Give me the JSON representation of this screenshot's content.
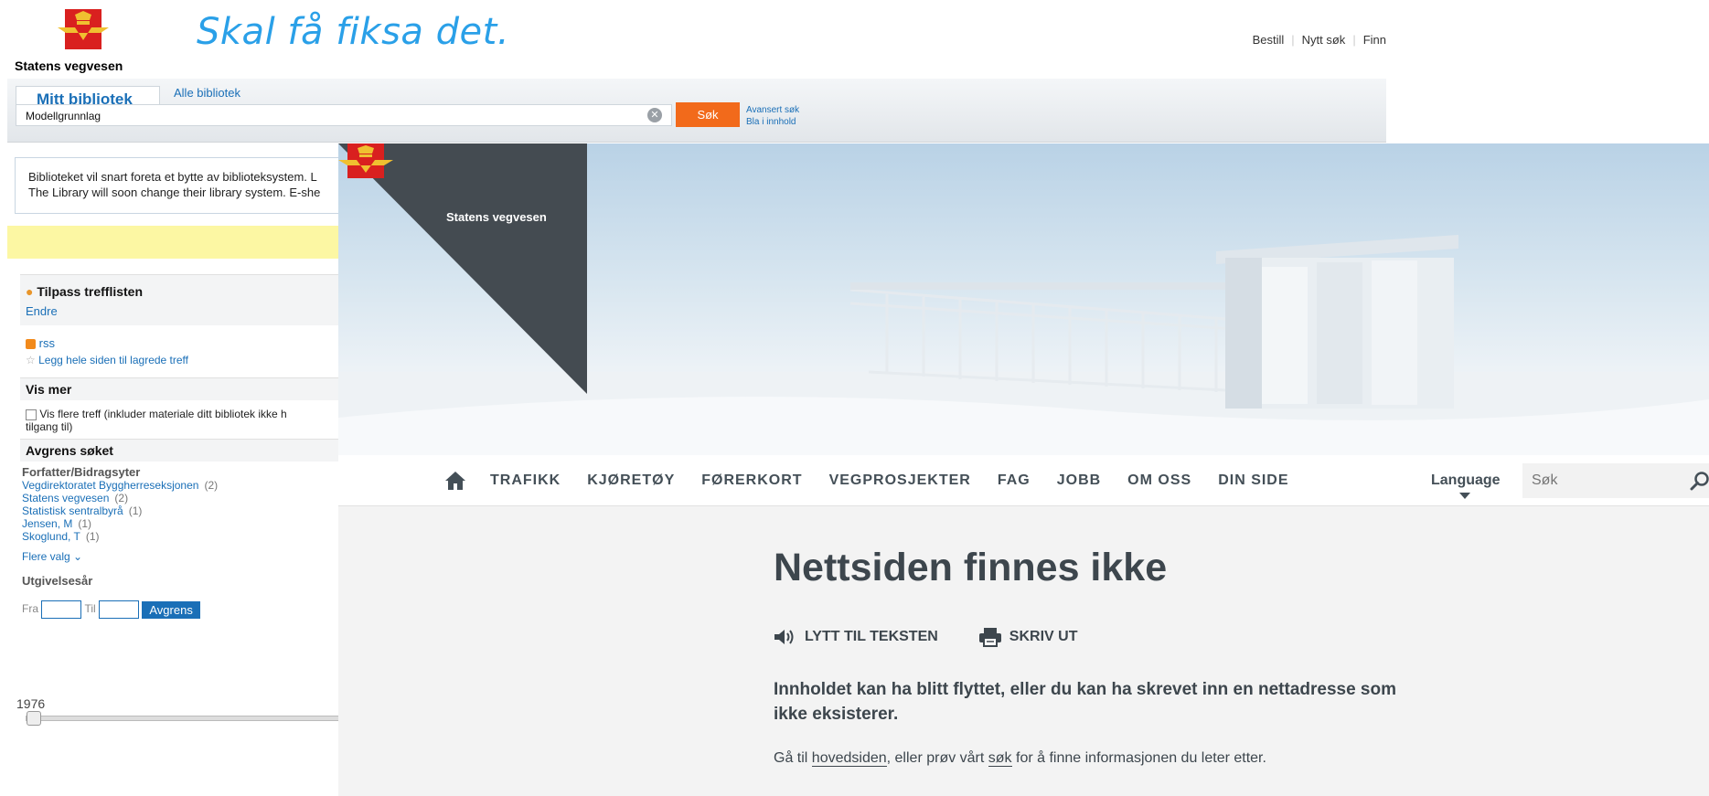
{
  "library": {
    "brand_name": "Statens vegvesen",
    "handwriting": "Skal få fiksa det.",
    "top_links": [
      "Bestill",
      "Nytt søk",
      "Finn"
    ],
    "tabs": {
      "active": "Mitt bibliotek",
      "other": "Alle bibliotek"
    },
    "search": {
      "value": "Modellgrunnlag",
      "button": "Søk"
    },
    "advanced": {
      "advanced_search": "Avansert søk",
      "browse": "Bla i innhold"
    },
    "notice": {
      "line1": "Biblioteket vil snart foreta et bytte av biblioteksystem. L",
      "line2": "The Library will soon change their library system. E-she"
    },
    "customize": {
      "title": "Tilpass trefflisten",
      "edit": "Endre"
    },
    "links": {
      "rss": "rss",
      "save_page": "Legg hele siden til lagrede treff"
    },
    "show_more": {
      "title": "Vis mer",
      "checkbox_label": "Vis flere treff (inkluder materiale ditt bibliotek ikke h",
      "checkbox_label_2": "tilgang til)"
    },
    "refine": {
      "title": "Avgrens søket",
      "author_heading": "Forfatter/Bidragsyter",
      "authors": [
        {
          "name": "Vegdirektoratet Byggherreseksjonen",
          "count": "(2)"
        },
        {
          "name": "Statens vegvesen",
          "count": "(2)"
        },
        {
          "name": "Statistisk sentralbyrå",
          "count": "(1)"
        },
        {
          "name": "Jensen, M",
          "count": "(1)"
        },
        {
          "name": "Skoglund, T",
          "count": "(1)"
        }
      ],
      "more_options": "Flere valg",
      "year_heading": "Utgivelsesår",
      "from_label": "Fra",
      "to_label": "Til",
      "apply": "Avgrens",
      "slider_min": "1976"
    }
  },
  "site": {
    "logo_text": "Statens vegvesen",
    "nav": {
      "items": [
        "TRAFIKK",
        "KJØRETØY",
        "FØRERKORT",
        "VEGPROSJEKTER",
        "FAG",
        "JOBB",
        "OM OSS",
        "DIN SIDE"
      ],
      "language": "Language",
      "search_placeholder": "Søk"
    },
    "page": {
      "title": "Nettsiden finnes ikke",
      "listen": "LYTT TIL TEKSTEN",
      "print": "SKRIV UT",
      "lead": "Innholdet kan ha blitt flyttet, eller du kan ha skrevet inn en nettadresse som ikke eksisterer.",
      "body_prefix": "Gå til ",
      "home_link": "hovedsiden",
      "body_middle": ", eller prøv vårt ",
      "search_link": "søk",
      "body_suffix": " for å finne informasjonen du leter etter."
    }
  },
  "colors": {
    "brand_red": "#d9201f",
    "brand_gold": "#f0c030",
    "library_blue": "#1a6fb7",
    "search_orange": "#f26a1b",
    "site_dark": "#444b51",
    "text_dark": "#3d464d"
  }
}
